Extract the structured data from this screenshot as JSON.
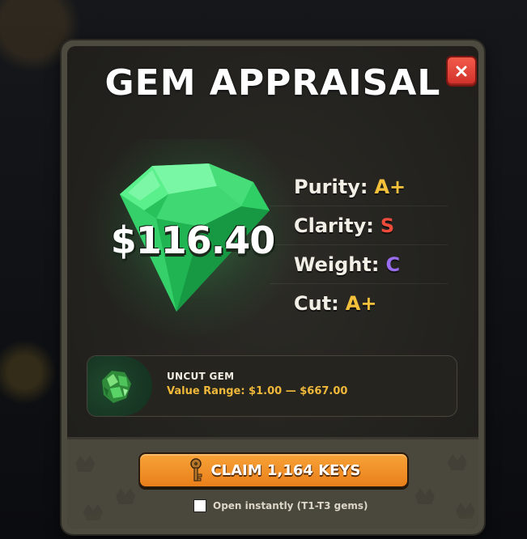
{
  "dialog": {
    "title": "GEM APPRAISAL",
    "close_icon": "close-icon"
  },
  "gem": {
    "icon": "emerald-gem-icon",
    "value": "$116.40",
    "color": "#2ee06a"
  },
  "stats": [
    {
      "label": "Purity:",
      "grade": "A+",
      "color": "#f4c13c"
    },
    {
      "label": "Clarity:",
      "grade": "S",
      "color": "#ee4b3b"
    },
    {
      "label": "Weight:",
      "grade": "C",
      "color": "#9a6cf0"
    },
    {
      "label": "Cut:",
      "grade": "A+",
      "color": "#f4c13c"
    }
  ],
  "item": {
    "icon": "uncut-gem-icon",
    "name": "UNCUT GEM",
    "range": "Value Range: $1.00 — $667.00"
  },
  "footer": {
    "claim_icon": "key-icon",
    "claim_label": "CLAIM 1,164 KEYS",
    "instant_checked": false,
    "instant_label": "Open instantly (T1-T3 gems)"
  }
}
